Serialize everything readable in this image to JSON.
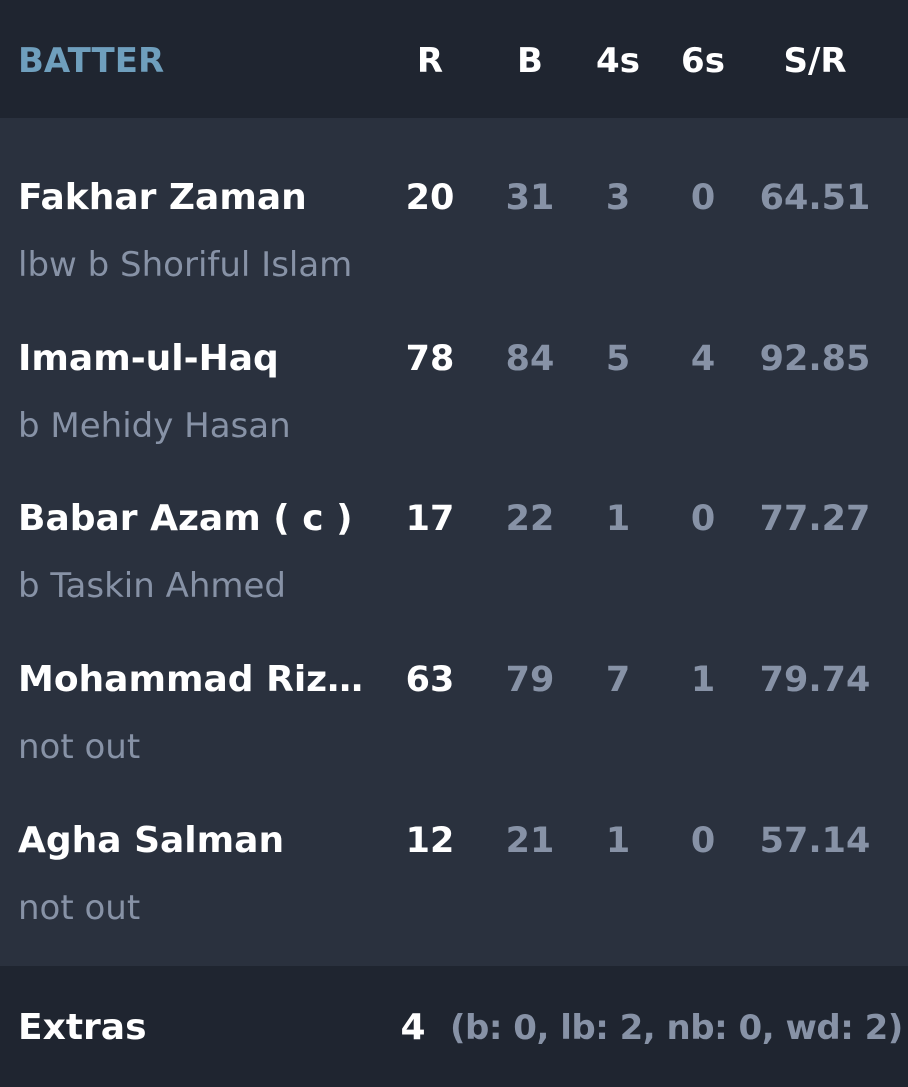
{
  "header": {
    "batter": "BATTER",
    "runs": "R",
    "balls": "B",
    "fours": "4s",
    "sixes": "6s",
    "strike_rate": "S/R"
  },
  "batters": [
    {
      "name": "Fakhar Zaman",
      "dismissal": "lbw b Shoriful Islam",
      "runs": "20",
      "balls": "31",
      "fours": "3",
      "sixes": "0",
      "sr": "64.51"
    },
    {
      "name": "Imam-ul-Haq",
      "dismissal": "b Mehidy Hasan",
      "runs": "78",
      "balls": "84",
      "fours": "5",
      "sixes": "4",
      "sr": "92.85"
    },
    {
      "name": "Babar Azam ( c )",
      "dismissal": "b Taskin Ahmed",
      "runs": "17",
      "balls": "22",
      "fours": "1",
      "sixes": "0",
      "sr": "77.27"
    },
    {
      "name": "Mohammad Rizwa...",
      "dismissal": "not out",
      "runs": "63",
      "balls": "79",
      "fours": "7",
      "sixes": "1",
      "sr": "79.74"
    },
    {
      "name": "Agha Salman",
      "dismissal": "not out",
      "runs": "12",
      "balls": "21",
      "fours": "1",
      "sixes": "0",
      "sr": "57.14"
    }
  ],
  "extras": {
    "label": "Extras",
    "total": "4",
    "detail": "(b: 0, lb: 2, nb: 0, wd: 2)"
  },
  "colors": {
    "header_bg": "#1f2530",
    "body_bg": "#2a313e",
    "accent_header": "#6f9fbd",
    "muted_text": "#8792a6",
    "primary_text": "#ffffff"
  }
}
